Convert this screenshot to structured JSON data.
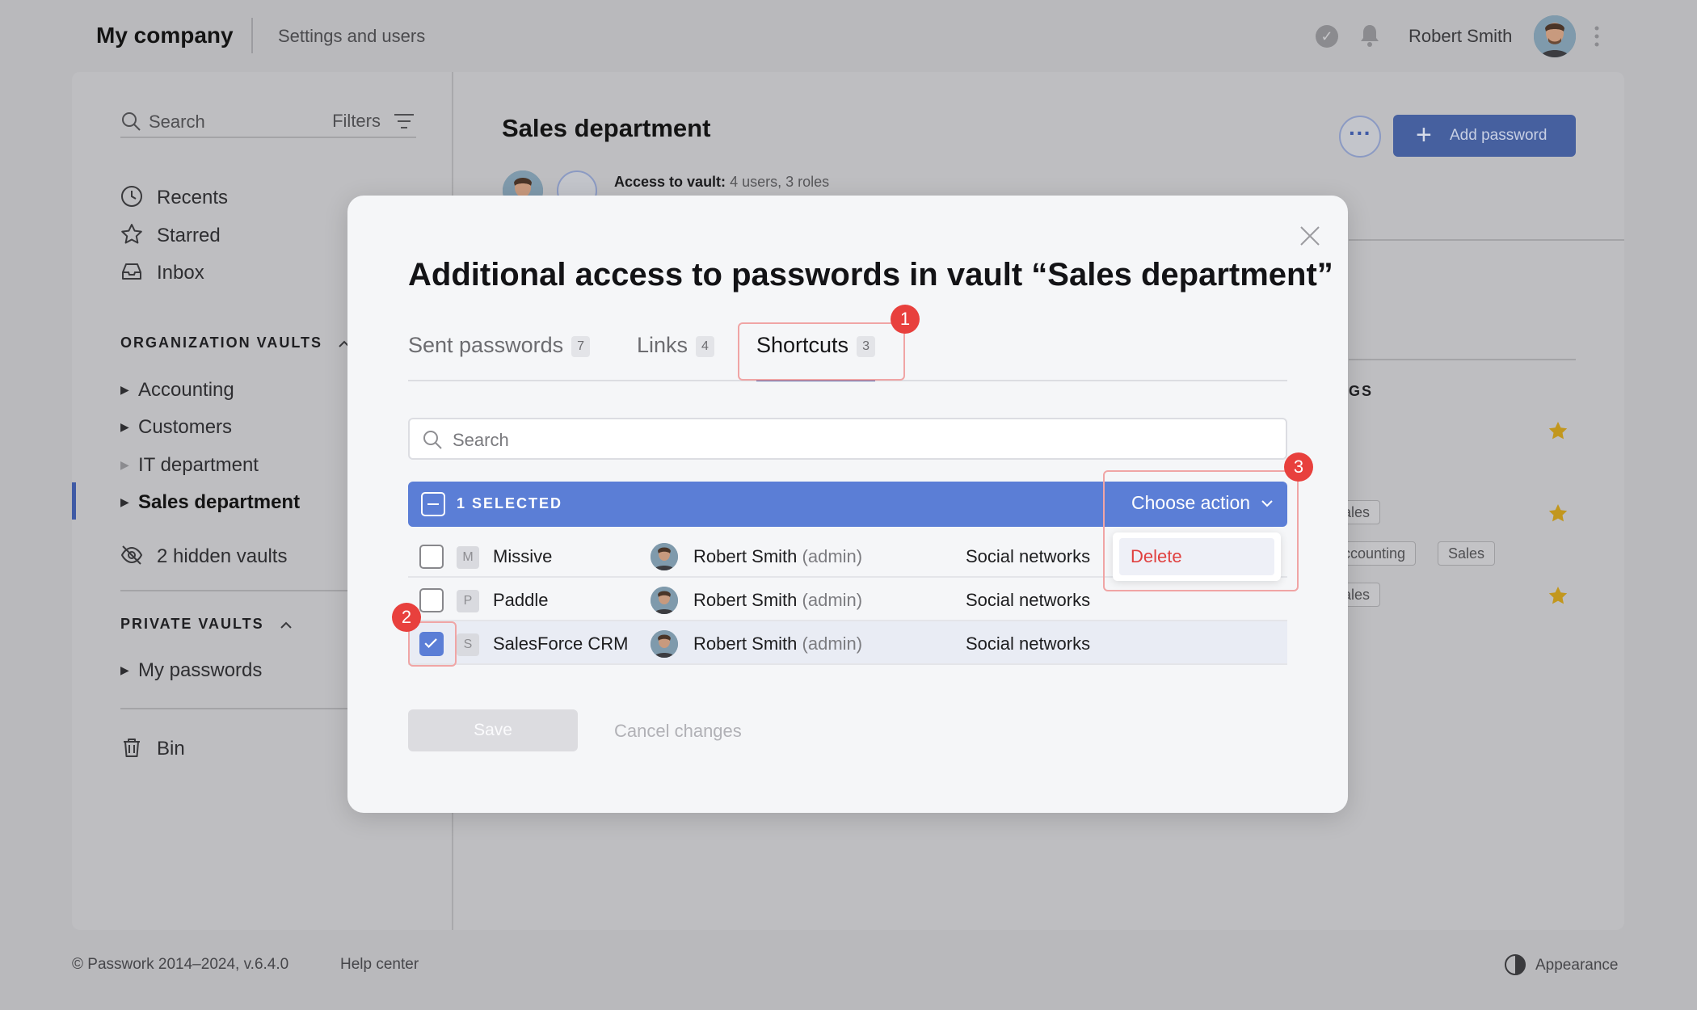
{
  "topbar": {
    "brand": "My company",
    "breadcrumb": "Settings and users",
    "user_name": "Robert Smith"
  },
  "sidebar": {
    "search_placeholder": "Search",
    "filters_label": "Filters",
    "nav": [
      {
        "label": "Recents",
        "icon": "clock-icon"
      },
      {
        "label": "Starred",
        "icon": "star-icon"
      },
      {
        "label": "Inbox",
        "icon": "inbox-icon"
      }
    ],
    "org_vaults_heading": "ORGANIZATION VAULTS",
    "org_vaults": [
      {
        "label": "Accounting"
      },
      {
        "label": "Customers"
      },
      {
        "label": "IT department"
      },
      {
        "label": "Sales department",
        "active": true
      }
    ],
    "hidden_vaults": "2 hidden vaults",
    "private_vaults_heading": "PRIVATE VAULTS",
    "private_vaults": [
      {
        "label": "My passwords"
      }
    ],
    "bin_label": "Bin"
  },
  "main": {
    "title": "Sales department",
    "access_label": "Access to vault:",
    "access_value": "4 users, 3 roles",
    "add_password_label": "Add password",
    "column_heading_fragment": "GS",
    "tags": [
      "ales",
      "ccounting",
      "Sales",
      "ales"
    ]
  },
  "footer": {
    "copyright": "© Passwork 2014–2024, v.6.4.0",
    "help": "Help center",
    "appearance": "Appearance"
  },
  "modal": {
    "title": "Additional access to passwords in vault “Sales department”",
    "tabs": [
      {
        "label": "Sent passwords",
        "count": "7"
      },
      {
        "label": "Links",
        "count": "4"
      },
      {
        "label": "Shortcuts",
        "count": "3",
        "active": true
      }
    ],
    "search_placeholder": "Search",
    "selection_label": "1 SELECTED",
    "choose_action_label": "Choose action",
    "dropdown_items": [
      "Delete"
    ],
    "rows": [
      {
        "letter": "M",
        "name": "Missive",
        "user": "Robert Smith",
        "role": "(admin)",
        "category": "Social networks",
        "checked": false
      },
      {
        "letter": "P",
        "name": "Paddle",
        "user": "Robert Smith",
        "role": "(admin)",
        "category": "Social networks",
        "checked": false
      },
      {
        "letter": "S",
        "name": "SalesForce CRM",
        "user": "Robert Smith",
        "role": "(admin)",
        "category": "Social networks",
        "checked": true
      }
    ],
    "save_label": "Save",
    "cancel_label": "Cancel changes",
    "callouts": [
      "1",
      "2",
      "3"
    ]
  },
  "colors": {
    "accent": "#5b7ed6",
    "danger": "#e0403f",
    "callout": "#e8403d",
    "star": "#c2971e"
  }
}
